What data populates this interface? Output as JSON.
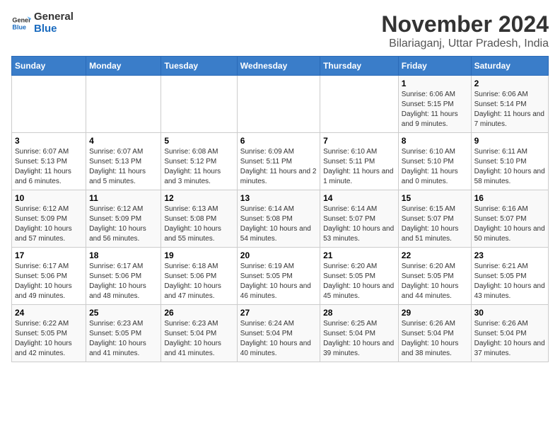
{
  "logo": {
    "line1": "General",
    "line2": "Blue"
  },
  "title": "November 2024",
  "subtitle": "Bilariaganj, Uttar Pradesh, India",
  "headers": [
    "Sunday",
    "Monday",
    "Tuesday",
    "Wednesday",
    "Thursday",
    "Friday",
    "Saturday"
  ],
  "weeks": [
    [
      {
        "day": "",
        "info": ""
      },
      {
        "day": "",
        "info": ""
      },
      {
        "day": "",
        "info": ""
      },
      {
        "day": "",
        "info": ""
      },
      {
        "day": "",
        "info": ""
      },
      {
        "day": "1",
        "info": "Sunrise: 6:06 AM\nSunset: 5:15 PM\nDaylight: 11 hours and 9 minutes."
      },
      {
        "day": "2",
        "info": "Sunrise: 6:06 AM\nSunset: 5:14 PM\nDaylight: 11 hours and 7 minutes."
      }
    ],
    [
      {
        "day": "3",
        "info": "Sunrise: 6:07 AM\nSunset: 5:13 PM\nDaylight: 11 hours and 6 minutes."
      },
      {
        "day": "4",
        "info": "Sunrise: 6:07 AM\nSunset: 5:13 PM\nDaylight: 11 hours and 5 minutes."
      },
      {
        "day": "5",
        "info": "Sunrise: 6:08 AM\nSunset: 5:12 PM\nDaylight: 11 hours and 3 minutes."
      },
      {
        "day": "6",
        "info": "Sunrise: 6:09 AM\nSunset: 5:11 PM\nDaylight: 11 hours and 2 minutes."
      },
      {
        "day": "7",
        "info": "Sunrise: 6:10 AM\nSunset: 5:11 PM\nDaylight: 11 hours and 1 minute."
      },
      {
        "day": "8",
        "info": "Sunrise: 6:10 AM\nSunset: 5:10 PM\nDaylight: 11 hours and 0 minutes."
      },
      {
        "day": "9",
        "info": "Sunrise: 6:11 AM\nSunset: 5:10 PM\nDaylight: 10 hours and 58 minutes."
      }
    ],
    [
      {
        "day": "10",
        "info": "Sunrise: 6:12 AM\nSunset: 5:09 PM\nDaylight: 10 hours and 57 minutes."
      },
      {
        "day": "11",
        "info": "Sunrise: 6:12 AM\nSunset: 5:09 PM\nDaylight: 10 hours and 56 minutes."
      },
      {
        "day": "12",
        "info": "Sunrise: 6:13 AM\nSunset: 5:08 PM\nDaylight: 10 hours and 55 minutes."
      },
      {
        "day": "13",
        "info": "Sunrise: 6:14 AM\nSunset: 5:08 PM\nDaylight: 10 hours and 54 minutes."
      },
      {
        "day": "14",
        "info": "Sunrise: 6:14 AM\nSunset: 5:07 PM\nDaylight: 10 hours and 53 minutes."
      },
      {
        "day": "15",
        "info": "Sunrise: 6:15 AM\nSunset: 5:07 PM\nDaylight: 10 hours and 51 minutes."
      },
      {
        "day": "16",
        "info": "Sunrise: 6:16 AM\nSunset: 5:07 PM\nDaylight: 10 hours and 50 minutes."
      }
    ],
    [
      {
        "day": "17",
        "info": "Sunrise: 6:17 AM\nSunset: 5:06 PM\nDaylight: 10 hours and 49 minutes."
      },
      {
        "day": "18",
        "info": "Sunrise: 6:17 AM\nSunset: 5:06 PM\nDaylight: 10 hours and 48 minutes."
      },
      {
        "day": "19",
        "info": "Sunrise: 6:18 AM\nSunset: 5:06 PM\nDaylight: 10 hours and 47 minutes."
      },
      {
        "day": "20",
        "info": "Sunrise: 6:19 AM\nSunset: 5:05 PM\nDaylight: 10 hours and 46 minutes."
      },
      {
        "day": "21",
        "info": "Sunrise: 6:20 AM\nSunset: 5:05 PM\nDaylight: 10 hours and 45 minutes."
      },
      {
        "day": "22",
        "info": "Sunrise: 6:20 AM\nSunset: 5:05 PM\nDaylight: 10 hours and 44 minutes."
      },
      {
        "day": "23",
        "info": "Sunrise: 6:21 AM\nSunset: 5:05 PM\nDaylight: 10 hours and 43 minutes."
      }
    ],
    [
      {
        "day": "24",
        "info": "Sunrise: 6:22 AM\nSunset: 5:05 PM\nDaylight: 10 hours and 42 minutes."
      },
      {
        "day": "25",
        "info": "Sunrise: 6:23 AM\nSunset: 5:05 PM\nDaylight: 10 hours and 41 minutes."
      },
      {
        "day": "26",
        "info": "Sunrise: 6:23 AM\nSunset: 5:04 PM\nDaylight: 10 hours and 41 minutes."
      },
      {
        "day": "27",
        "info": "Sunrise: 6:24 AM\nSunset: 5:04 PM\nDaylight: 10 hours and 40 minutes."
      },
      {
        "day": "28",
        "info": "Sunrise: 6:25 AM\nSunset: 5:04 PM\nDaylight: 10 hours and 39 minutes."
      },
      {
        "day": "29",
        "info": "Sunrise: 6:26 AM\nSunset: 5:04 PM\nDaylight: 10 hours and 38 minutes."
      },
      {
        "day": "30",
        "info": "Sunrise: 6:26 AM\nSunset: 5:04 PM\nDaylight: 10 hours and 37 minutes."
      }
    ]
  ]
}
